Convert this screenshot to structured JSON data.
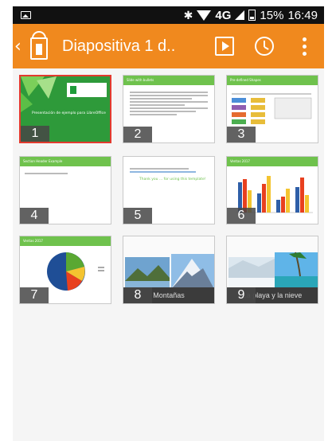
{
  "status_bar": {
    "network": "4G",
    "battery": "15%",
    "time": "16:49",
    "icons": [
      "image-icon",
      "bluetooth-icon",
      "wifi-icon",
      "cell-signal-icon",
      "battery-icon"
    ]
  },
  "action_bar": {
    "title": "Diapositiva 1 d..",
    "back_icon": "chevron-left-icon",
    "app_icon": "impress-remote-icon",
    "buttons": [
      "play-icon",
      "clock-icon",
      "more-vert-icon"
    ],
    "background": "#f0891e"
  },
  "slides": [
    {
      "number": "1",
      "title": "Presentación de ejemplo para LibreOffice",
      "selected": true
    },
    {
      "number": "2",
      "title": "Slide with bullets"
    },
    {
      "number": "3",
      "title": "Pre-defined Shapes"
    },
    {
      "number": "4",
      "title": "Section Header Example"
    },
    {
      "number": "5",
      "title": "Thank you ... for using this template!"
    },
    {
      "number": "6",
      "title": "Ventas 2017"
    },
    {
      "number": "7",
      "title": "Ventas 2017"
    },
    {
      "number": "8",
      "caption": "Montañas"
    },
    {
      "number": "9",
      "caption": "La playa y la nieve"
    }
  ],
  "colors": {
    "selected_border": "#e23a2e",
    "accent_green": "#6fc24d"
  }
}
